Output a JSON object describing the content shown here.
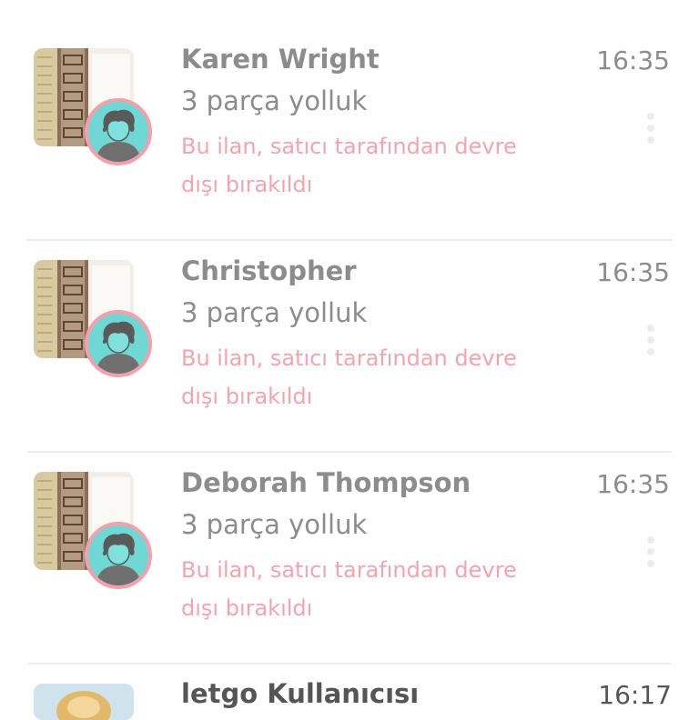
{
  "conversations": [
    {
      "name": "Karen Wright",
      "time": "16:35",
      "title": "3 parça yolluk",
      "status": "Bu ilan, satıcı tarafından devre dışı bırakıldı"
    },
    {
      "name": "Christopher",
      "time": "16:35",
      "title": "3 parça yolluk",
      "status": "Bu ilan, satıcı tarafından devre dışı bırakıldı"
    },
    {
      "name": "Deborah Thompson",
      "time": "16:35",
      "title": "3 parça yolluk",
      "status": "Bu ilan, satıcı tarafından devre dışı bırakıldı"
    }
  ],
  "partial_conversation": {
    "name": "letgo Kullanıcısı",
    "time": "16:17"
  },
  "colors": {
    "text_gray": "#8c8c8c",
    "status_pink": "#f7a3ae",
    "avatar_bg": "#6fd7d4",
    "avatar_ring": "#f3a0ac",
    "divider": "#ececec"
  },
  "icons": {
    "menu": "more-vertical-icon",
    "avatar": "default-user-avatar-icon"
  }
}
